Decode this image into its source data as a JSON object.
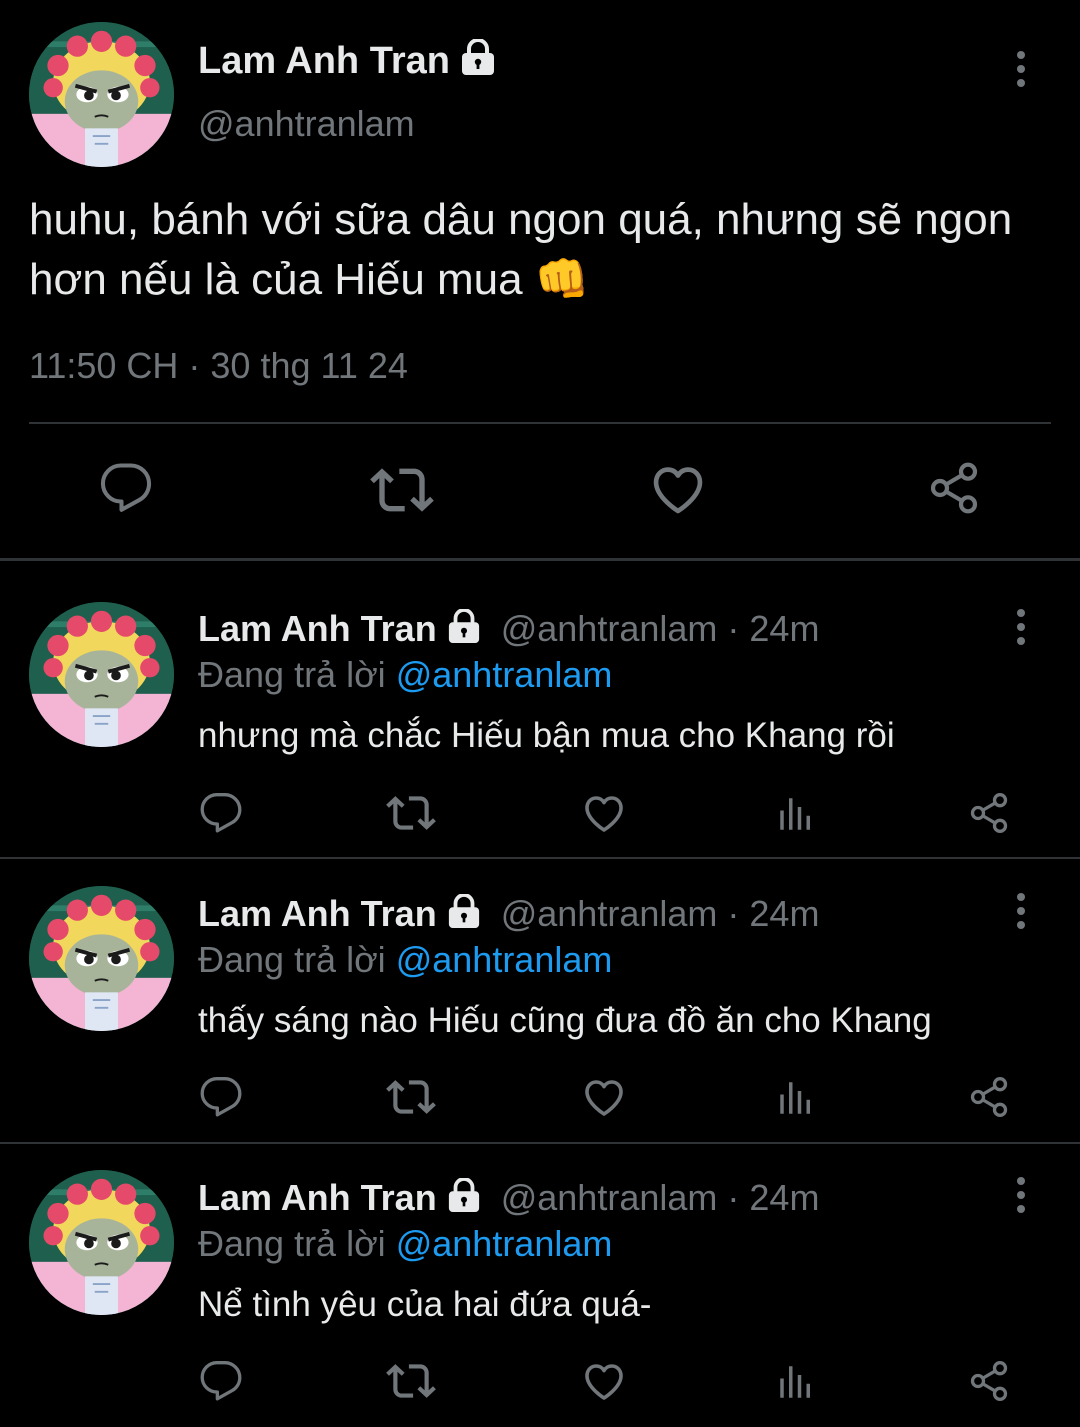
{
  "main_tweet": {
    "author_name": "Lam Anh Tran",
    "handle": "@anhtranlam",
    "text": "huhu, bánh với sữa dâu ngon quá, nhưng sẽ ngon hơn nếu là của Hiếu mua",
    "emoji": "👊",
    "timestamp": "11:50 CH · 30 thg 11 24"
  },
  "replies": [
    {
      "author_name": "Lam Anh Tran",
      "handle": "@anhtranlam",
      "separator": "·",
      "time": "24m",
      "replying_prefix": "Đang trả lời",
      "replying_to": "@anhtranlam",
      "text": "nhưng mà chắc Hiếu bận mua cho Khang rồi"
    },
    {
      "author_name": "Lam Anh Tran",
      "handle": "@anhtranlam",
      "separator": "·",
      "time": "24m",
      "replying_prefix": "Đang trả lời",
      "replying_to": "@anhtranlam",
      "text": "thấy sáng nào Hiếu cũng đưa đồ ăn cho Khang"
    },
    {
      "author_name": "Lam Anh Tran",
      "handle": "@anhtranlam",
      "separator": "·",
      "time": "24m",
      "replying_prefix": "Đang trả lời",
      "replying_to": "@anhtranlam",
      "text": "Nể tình yêu của hai đứa quá-"
    }
  ],
  "icons": {
    "lock": "lock-icon",
    "more": "more-vertical-icon",
    "reply": "reply-icon",
    "retweet": "retweet-icon",
    "like": "heart-icon",
    "views": "views-icon",
    "share": "share-icon"
  },
  "colors": {
    "background": "#000000",
    "text": "#e7e9ea",
    "secondary": "#71767b",
    "link": "#1d9bf0",
    "divider": "#2f3336"
  }
}
